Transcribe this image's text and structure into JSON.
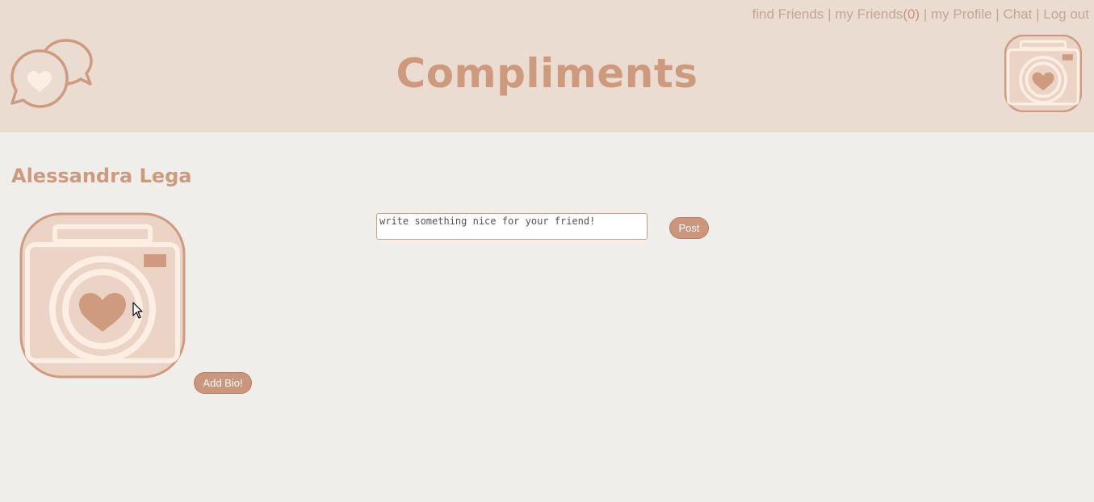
{
  "header": {
    "title": "Compliments",
    "nav": {
      "find_friends": "find Friends",
      "my_friends": "my Friends",
      "friend_count": "(0)",
      "my_profile": "my Profile",
      "chat": "Chat",
      "logout": "Log out",
      "separator": "|"
    }
  },
  "profile": {
    "name": "Alessandra Lega",
    "add_bio_label": "Add Bio!"
  },
  "compliment": {
    "placeholder": "write something nice for your friend!",
    "value": "",
    "post_label": "Post"
  },
  "colors": {
    "header_bg": "#eadcd1",
    "page_bg": "#f0eeea",
    "accent": "#ce9a7e",
    "button_bg": "#cc967d",
    "photo_bg": "#ebd3c6",
    "photo_light": "#fdeee3"
  },
  "icons": {
    "logo": "speech-bubbles-heart-icon",
    "avatar": "camera-heart-icon",
    "cursor": "mouse-pointer-icon"
  }
}
